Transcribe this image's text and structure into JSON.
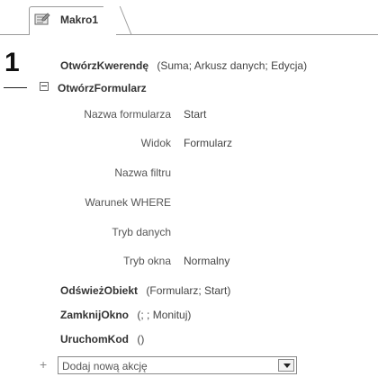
{
  "tab": {
    "label": "Makro1",
    "icon": "macro-icon"
  },
  "callout": {
    "number": "1"
  },
  "actions": [
    {
      "name": "OtwórzKwerendę",
      "args": "(Suma; Arkusz danych; Edycja)"
    },
    {
      "name": "OtwórzFormularz"
    },
    {
      "name": "OdświeżObiekt",
      "args": "(Formularz; Start)"
    },
    {
      "name": "ZamknijOkno",
      "args": "(; ; Monituj)"
    },
    {
      "name": "UruchomKod",
      "args": "()"
    }
  ],
  "form_args": [
    {
      "label": "Nazwa formularza",
      "value": "Start"
    },
    {
      "label": "Widok",
      "value": "Formularz"
    },
    {
      "label": "Nazwa filtru",
      "value": ""
    },
    {
      "label": "Warunek WHERE",
      "value": ""
    },
    {
      "label": "Tryb danych",
      "value": ""
    },
    {
      "label": "Tryb okna",
      "value": "Normalny"
    }
  ],
  "add_action": {
    "placeholder": "Dodaj nową akcję"
  }
}
